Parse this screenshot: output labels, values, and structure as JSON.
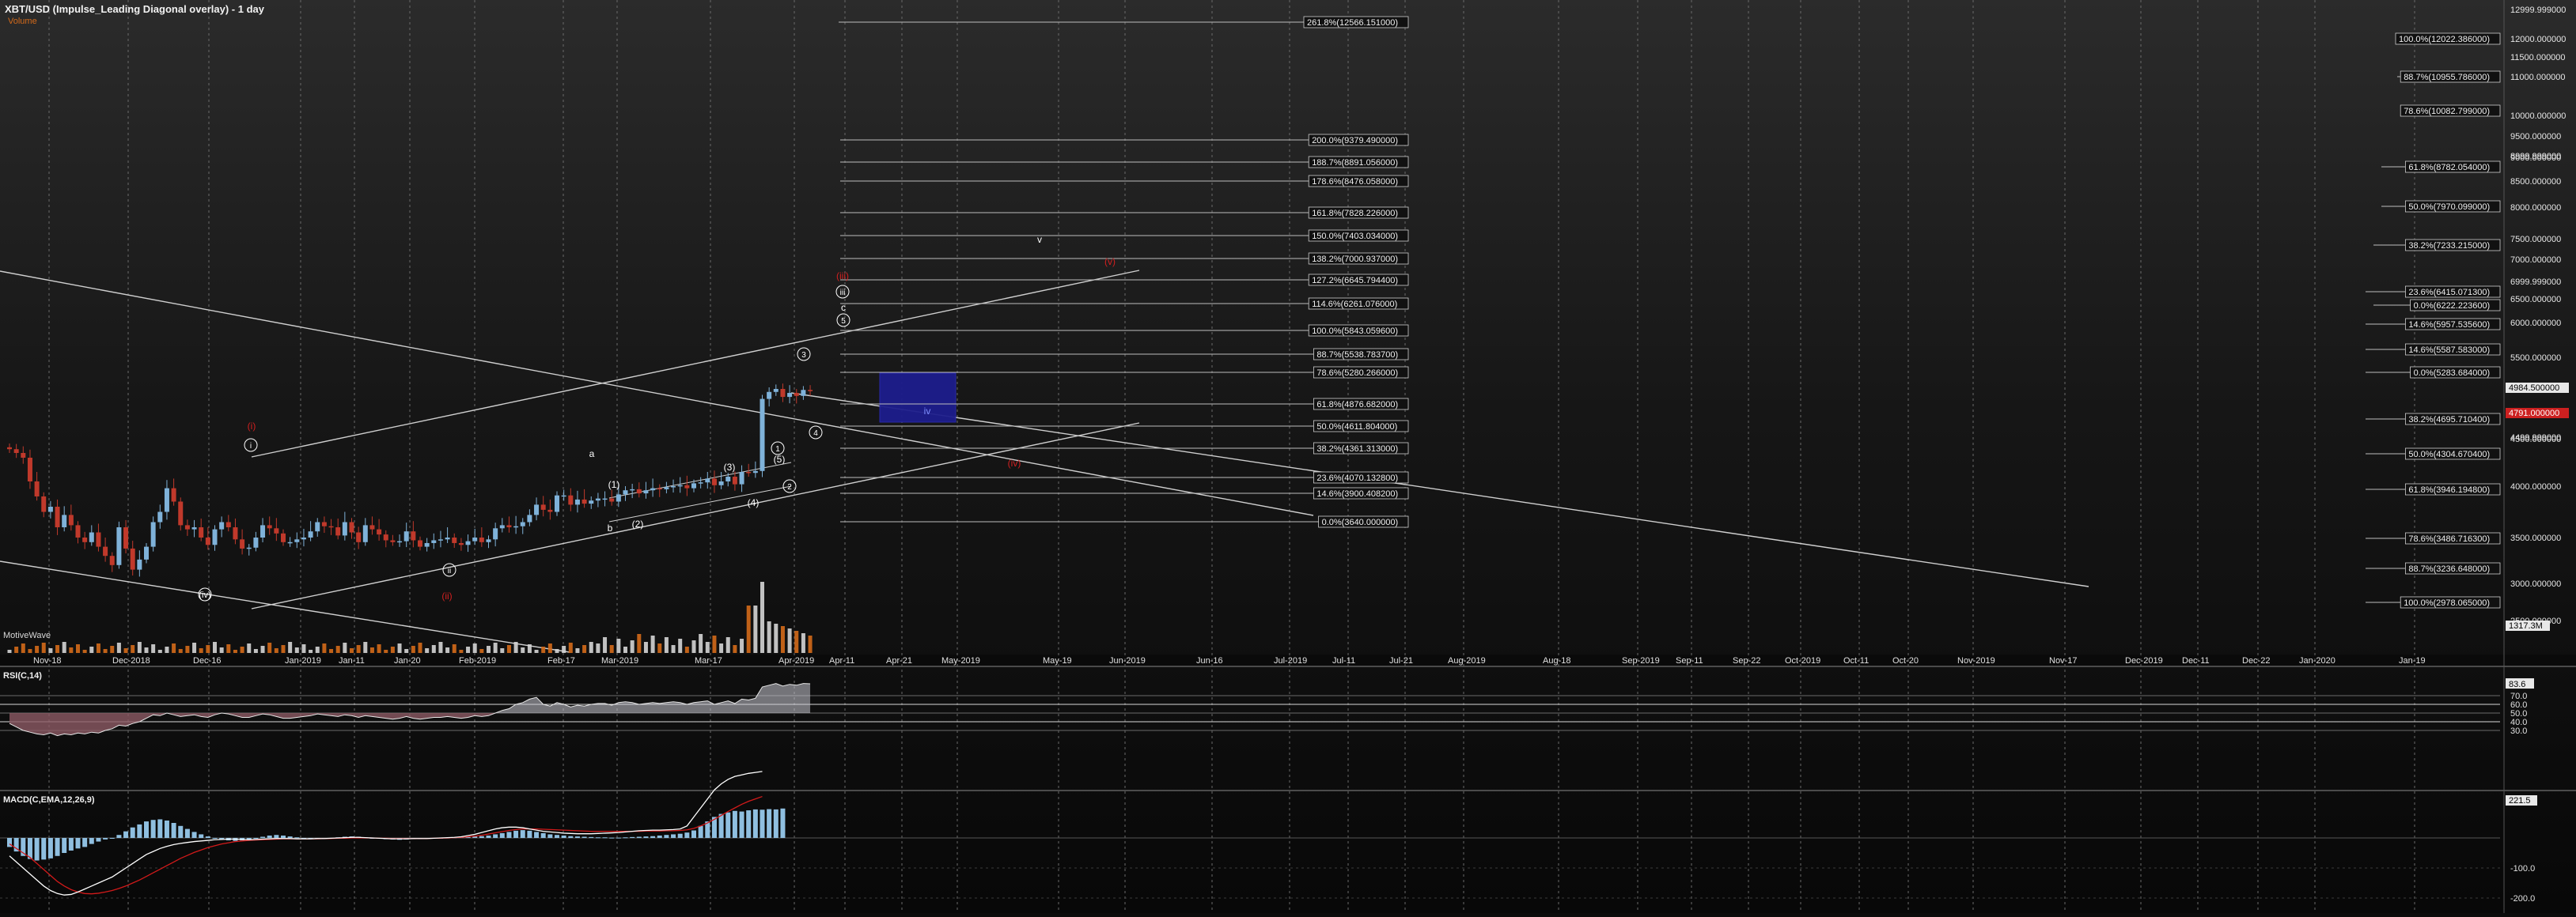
{
  "header": {
    "title": "XBT/USD (Impulse_Leading Diagonal overlay) - 1 day",
    "subtitle": "Volume",
    "watermark": "MotiveWave"
  },
  "colors": {
    "up_candle": "#7fb2d9",
    "down_candle": "#c0392b",
    "red_label": "#d22020",
    "box": "#1d1d8c",
    "rsi_fill_up": "#c8c8d2",
    "rsi_fill_down": "#8c5a64",
    "macd_hist": "#8fbfe0",
    "macd_line": "#ffffff",
    "signal_line": "#d21a1a"
  },
  "chart_data": [
    {
      "type": "candlestick",
      "title": "XBT/USD (Impulse_Leading Diagonal overlay) - 1 day",
      "x_tick_labels": [
        "Nov-18",
        "Dec-2018",
        "Dec-16",
        "Jan-2019",
        "Jan-11",
        "Jan-20",
        "Feb-2019",
        "Feb-17",
        "Mar-2019",
        "Mar-17",
        "Apr-2019",
        "Apr-11",
        "Apr-21",
        "May-2019",
        "May-19",
        "Jun-2019",
        "Jun-16",
        "Jul-2019",
        "Jul-11",
        "Jul-21",
        "Aug-2019",
        "Aug-18",
        "Sep-2019",
        "Sep-11",
        "Sep-22",
        "Oct-2019",
        "Oct-11",
        "Oct-20",
        "Nov-2019",
        "Nov-17",
        "Dec-2019",
        "Dec-11",
        "Dec-22",
        "Jan-2020",
        "Jan-19"
      ],
      "y_tick_labels": [
        "12999.999000",
        "12000.000000",
        "11500.000000",
        "11000.000000",
        "10000.000000",
        "9500.000000",
        "9000.000000",
        "8999.999000",
        "8500.000000",
        "8000.000000",
        "7500.000000",
        "7000.000000",
        "6500.000000",
        "6999.999000",
        "6000.000000",
        "5500.000000",
        "5000.000000",
        "4500.000000",
        "4499.999000",
        "4000.000000",
        "3500.000000",
        "3000.000000",
        "2500.000000"
      ],
      "last_price_labels": [
        "4984.500000",
        "4791.000000"
      ],
      "volume_label": "1317.3M",
      "closes": [
        4390,
        4350,
        4300,
        4050,
        3900,
        3750,
        3800,
        3600,
        3720,
        3620,
        3500,
        3450,
        3550,
        3400,
        3300,
        3200,
        3600,
        3380,
        3150,
        3260,
        3400,
        3650,
        3750,
        3980,
        3850,
        3620,
        3580,
        3600,
        3500,
        3420,
        3580,
        3650,
        3600,
        3480,
        3380,
        3390,
        3500,
        3620,
        3590,
        3540,
        3450,
        3450,
        3480,
        3500,
        3560,
        3650,
        3610,
        3600,
        3520,
        3650,
        3550,
        3450,
        3620,
        3580,
        3530,
        3470,
        3450,
        3460,
        3560,
        3470,
        3400,
        3440,
        3470,
        3480,
        3500,
        3440,
        3420,
        3460,
        3500,
        3450,
        3480,
        3590,
        3620,
        3600,
        3610,
        3650,
        3720,
        3820,
        3770,
        3750,
        3910,
        3910,
        3820,
        3870,
        3830,
        3860,
        3880,
        3880,
        3850,
        3920,
        3960,
        3970,
        3930,
        3960,
        3980,
        3970,
        3990,
        4000,
        4010,
        3980,
        4030,
        4040,
        4080,
        4010,
        4050,
        4100,
        4020,
        4150,
        4140,
        4160,
        4900,
        4970,
        5000,
        4920,
        4960,
        4930,
        4990,
        4984.5
      ]
    },
    {
      "type": "table",
      "name": "fib_labels",
      "rows": [
        "261.8%(12566.151000)",
        "100.0%(12022.386000)",
        "88.7%(10955.786000)",
        "78.6%(10082.799000)",
        "200.0%(9379.490000)",
        "188.7%(8891.056000)",
        "178.6%(8476.058000)",
        "61.8%(8782.054000)",
        "161.8%(7828.226000)",
        "50.0%(7970.099000)",
        "150.0%(7403.034000)",
        "38.2%(7233.215000)",
        "138.2%(7000.937000)",
        "127.2%(6645.794400)",
        "23.6%(6415.071300)",
        "114.6%(6261.076000)",
        "0.0%(6222.223600)",
        "14.6%(5957.535600)",
        "100.0%(5843.059600)",
        "14.6%(5587.583000)",
        "88.7%(5538.783700)",
        "78.6%(5280.266000)",
        "0.0%(5283.684000)",
        "61.8%(4876.682000)",
        "38.2%(4695.710400)",
        "50.0%(4611.804000)",
        "38.2%(4361.313000)",
        "50.0%(4304.670400)",
        "23.6%(4070.132800)",
        "14.6%(3900.408200)",
        "61.8%(3946.194800)",
        "0.0%(3640.000000)",
        "78.6%(3486.716300)",
        "88.7%(3236.648000)",
        "100.0%(2978.065000)"
      ]
    },
    {
      "type": "table",
      "name": "wave_labels",
      "rows": [
        "(i)",
        "(ii)",
        "(iii)",
        "(iv)",
        "(v)",
        "i",
        "ii",
        "iii",
        "iv",
        "v",
        "(i)",
        "(ii)",
        "(iii)",
        "(iv)",
        "(v)",
        "(1)",
        "(2)",
        "(3)",
        "(4)",
        "(5)",
        "1",
        "2",
        "3",
        "4",
        "5",
        "a",
        "b",
        "c"
      ]
    },
    {
      "type": "line",
      "title": "RSI(C,14)",
      "y_tick_labels": [
        "70.0",
        "60.0",
        "50.0",
        "40.0",
        "30.0"
      ],
      "last_value_label": "83.6",
      "values": [
        38,
        34,
        30,
        28,
        26,
        25,
        27,
        24,
        26,
        25,
        27,
        26,
        28,
        27,
        30,
        32,
        36,
        35,
        38,
        40,
        44,
        48,
        47,
        50,
        48,
        46,
        47,
        48,
        46,
        45,
        48,
        50,
        49,
        47,
        45,
        45,
        47,
        49,
        48,
        46,
        44,
        44,
        45,
        46,
        47,
        49,
        48,
        47,
        46,
        48,
        47,
        45,
        47,
        46,
        45,
        44,
        43,
        44,
        46,
        44,
        43,
        44,
        45,
        45,
        46,
        45,
        44,
        45,
        47,
        46,
        47,
        50,
        53,
        55,
        60,
        62,
        66,
        68,
        60,
        58,
        62,
        60,
        57,
        59,
        58,
        60,
        61,
        61,
        59,
        62,
        63,
        62,
        60,
        61,
        62,
        61,
        62,
        63,
        62,
        60,
        62,
        63,
        64,
        60,
        62,
        64,
        61,
        66,
        65,
        67,
        80,
        82,
        84,
        81,
        83,
        82,
        84,
        83.6
      ]
    },
    {
      "type": "bar",
      "title": "MACD(C,EMA,12,26,9)",
      "y_tick_labels": [
        "-100.0",
        "-200.0"
      ],
      "last_value_label": "221.5",
      "histogram": [
        -30,
        -45,
        -60,
        -70,
        -75,
        -72,
        -68,
        -60,
        -50,
        -42,
        -35,
        -30,
        -20,
        -12,
        -5,
        0,
        10,
        22,
        35,
        45,
        55,
        60,
        62,
        58,
        50,
        40,
        30,
        20,
        12,
        5,
        0,
        -5,
        -8,
        -10,
        -8,
        -5,
        0,
        4,
        8,
        10,
        8,
        5,
        2,
        0,
        -2,
        -3,
        -2,
        0,
        2,
        4,
        5,
        4,
        2,
        0,
        -2,
        -4,
        -5,
        -6,
        -5,
        -4,
        -3,
        -2,
        -1,
        0,
        1,
        2,
        3,
        4,
        5,
        6,
        8,
        12,
        16,
        20,
        24,
        26,
        24,
        20,
        16,
        12,
        10,
        8,
        6,
        5,
        4,
        3,
        2,
        2,
        1,
        1,
        2,
        3,
        4,
        5,
        6,
        8,
        10,
        12,
        14,
        18,
        25,
        40,
        55,
        70,
        80,
        85,
        90,
        88,
        92,
        95,
        94,
        96,
        95,
        98
      ],
      "macd": [
        -60,
        -80,
        -100,
        -120,
        -140,
        -160,
        -175,
        -185,
        -190,
        -188,
        -180,
        -170,
        -160,
        -150,
        -140,
        -130,
        -115,
        -100,
        -85,
        -70,
        -55,
        -45,
        -35,
        -28,
        -22,
        -18,
        -15,
        -12,
        -10,
        -8,
        -6,
        -5,
        -4,
        -4,
        -5,
        -6,
        -5,
        -4,
        -3,
        -2,
        -2,
        -2,
        -3,
        -3,
        -3,
        -2,
        -2,
        -1,
        0,
        1,
        2,
        2,
        1,
        0,
        -1,
        -2,
        -3,
        -3,
        -3,
        -2,
        -2,
        -2,
        -1,
        0,
        1,
        2,
        4,
        8,
        12,
        18,
        24,
        30,
        34,
        36,
        36,
        34,
        30,
        26,
        22,
        20,
        18,
        16,
        15,
        14,
        14,
        14,
        15,
        16,
        17,
        18,
        20,
        22,
        24,
        25,
        26,
        26,
        27,
        28,
        30,
        40,
        70,
        100,
        130,
        160,
        180,
        195,
        205,
        210,
        215,
        218,
        221.5
      ],
      "signal": [
        -20,
        -35,
        -50,
        -65,
        -85,
        -105,
        -125,
        -145,
        -160,
        -172,
        -180,
        -185,
        -186,
        -184,
        -180,
        -175,
        -168,
        -160,
        -150,
        -140,
        -128,
        -116,
        -104,
        -92,
        -80,
        -68,
        -58,
        -48,
        -40,
        -32,
        -26,
        -20,
        -16,
        -12,
        -10,
        -8,
        -7,
        -6,
        -5,
        -4,
        -3,
        -3,
        -3,
        -3,
        -3,
        -3,
        -2,
        -2,
        -1,
        -1,
        0,
        0,
        0,
        0,
        -1,
        -1,
        -2,
        -2,
        -2,
        -2,
        -2,
        -2,
        -1,
        -1,
        0,
        1,
        2,
        4,
        6,
        9,
        13,
        17,
        21,
        25,
        28,
        30,
        30,
        30,
        29,
        28,
        27,
        26,
        25,
        24,
        23,
        22,
        22,
        22,
        22,
        22,
        22,
        22,
        22,
        23,
        23,
        23,
        24,
        24,
        25,
        27,
        32,
        40,
        50,
        62,
        75,
        88,
        100,
        112,
        122,
        130,
        138
      ]
    }
  ]
}
